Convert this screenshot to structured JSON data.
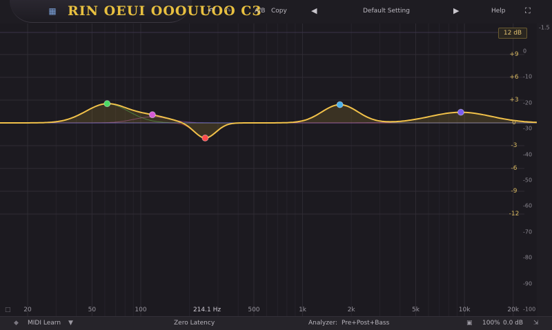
{
  "topbar": {
    "logo_text": "RIN OEUI OOOUUOO C3",
    "undo_icon": "undo-icon",
    "redo_icon": "redo-icon",
    "ab_label": "A/B",
    "copy_label": "Copy",
    "preset_name": "Default Setting",
    "help_label": "Help",
    "fullscreen_icon": "fullscreen-icon"
  },
  "display": {
    "scale_label": "12 dB",
    "analyzer_top_label": "-1.5",
    "hover_freq_label": "214.1 Hz",
    "freq_labels": [
      {
        "text": "20",
        "hz": 20
      },
      {
        "text": "50",
        "hz": 50
      },
      {
        "text": "100",
        "hz": 100
      },
      {
        "text": "500",
        "hz": 500
      },
      {
        "text": "1k",
        "hz": 1000
      },
      {
        "text": "2k",
        "hz": 2000
      },
      {
        "text": "5k",
        "hz": 5000
      },
      {
        "text": "10k",
        "hz": 10000
      },
      {
        "text": "20k",
        "hz": 20000
      }
    ],
    "gain_labels": [
      {
        "text": "+9",
        "db": 9
      },
      {
        "text": "+6",
        "db": 6
      },
      {
        "text": "+3",
        "db": 3
      },
      {
        "text": "0",
        "db": 0
      },
      {
        "text": "-3",
        "db": -3
      },
      {
        "text": "-6",
        "db": -6
      },
      {
        "text": "-9",
        "db": -9
      },
      {
        "text": "-12",
        "db": -12
      }
    ],
    "analyzer_labels": [
      "0",
      "-10",
      "-20",
      "-30",
      "-40",
      "-50",
      "-60",
      "-70",
      "-80",
      "-90",
      "-100"
    ],
    "bands": [
      {
        "name": "band-1",
        "hz": 62,
        "db": 2.5,
        "q": 1.0,
        "color": "#4cd964"
      },
      {
        "name": "band-2",
        "hz": 118,
        "db": 0.8,
        "q": 1.2,
        "color": "#d65bd6"
      },
      {
        "name": "band-3",
        "hz": 250,
        "db": -2.0,
        "q": 2.0,
        "color": "#ff4a4a"
      },
      {
        "name": "band-4",
        "hz": 1700,
        "db": 2.4,
        "q": 1.2,
        "color": "#4ab0ea"
      },
      {
        "name": "band-5",
        "hz": 9500,
        "db": 1.4,
        "q": 0.7,
        "color": "#7a5cf0"
      }
    ],
    "curve_color": "#f2c24a"
  },
  "bottombar": {
    "midi_learn_label": "MIDI Learn",
    "latency_label": "Zero Latency",
    "analyzer_label": "Analyzer:",
    "analyzer_value": "Pre+Post+Bass",
    "zoom_label": "100%",
    "output_gain_label": "0.0 dB"
  }
}
